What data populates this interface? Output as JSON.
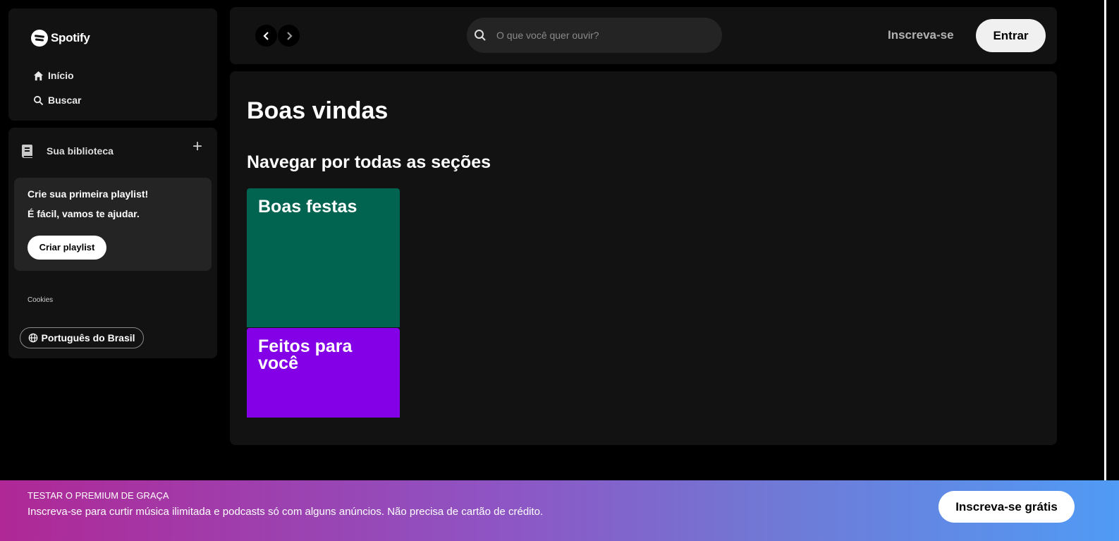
{
  "sidebar": {
    "logo_text": "Spotify",
    "nav": [
      {
        "label": "Início",
        "icon": "home-icon"
      },
      {
        "label": "Buscar",
        "icon": "search-icon"
      }
    ],
    "library": {
      "title": "Sua biblioteca",
      "add_symbol": "+",
      "promo": {
        "line1": "Crie sua primeira playlist!",
        "line2": "É fácil, vamos te ajudar.",
        "button": "Criar playlist"
      },
      "cookies": "Cookies",
      "language": "Português do Brasil"
    }
  },
  "topbar": {
    "search_placeholder": "O que você quer ouvir?",
    "signup": "Inscreva-se",
    "login": "Entrar"
  },
  "main": {
    "title": "Boas vindas",
    "section_title": "Navegar por todas as seções",
    "cards": [
      {
        "label": "Boas festas",
        "color": "#006450"
      },
      {
        "label": "Feitos para você",
        "color": "#8400e7"
      }
    ]
  },
  "banner": {
    "kicker": "TESTAR O PREMIUM DE GRAÇA",
    "description": "Inscreva-se para curtir música ilimitada e podcasts só com alguns anúncios. Não precisa de cartão de crédito.",
    "button": "Inscreva-se grátis"
  },
  "colors": {
    "background": "#000000",
    "panel": "#121212",
    "elevated": "#242424",
    "banner_start": "#af2896",
    "banner_end": "#509bf5"
  }
}
